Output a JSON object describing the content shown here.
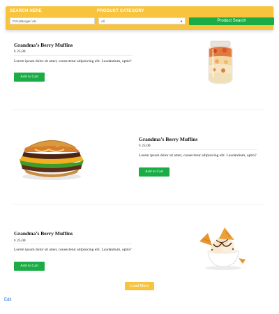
{
  "search": {
    "search_label": "SEARCH HERE",
    "search_placeholder": "Pizza/Burger/ etc",
    "category_label": "PRODUCT CATEGORY",
    "category_value": "All",
    "button_label": "Product Search"
  },
  "products": [
    {
      "title": "Grandma’s Berry Muffins",
      "price": "৳ 25.00",
      "description": "Lorem ipsum dolor sit amet, consectetur adipisicing elit. Laudantium, optio?",
      "button_label": "Add to Cart",
      "image_icon": "dessert-jar-image"
    },
    {
      "title": "Grandma’s Berry Muffins",
      "price": "৳ 25.00",
      "description": "Lorem ipsum dolor sit amet, consectetur adipisicing elit. Laudantium, optio?",
      "button_label": "Add to Cart",
      "image_icon": "burger-image"
    },
    {
      "title": "Grandma’s Berry Muffins",
      "price": "৳ 25.00",
      "description": "Lorem ipsum dolor sit amet, consectetur adipisicing elit. Laudantium, optio?",
      "button_label": "Add to Cart",
      "image_icon": "ice-cream-bowl-image"
    }
  ],
  "load_more_label": "Load More",
  "edit_label": "Edit",
  "colors": {
    "accent_yellow": "#f9c43d",
    "button_green": "#1aad45",
    "link_blue": "#2a6fd6"
  }
}
